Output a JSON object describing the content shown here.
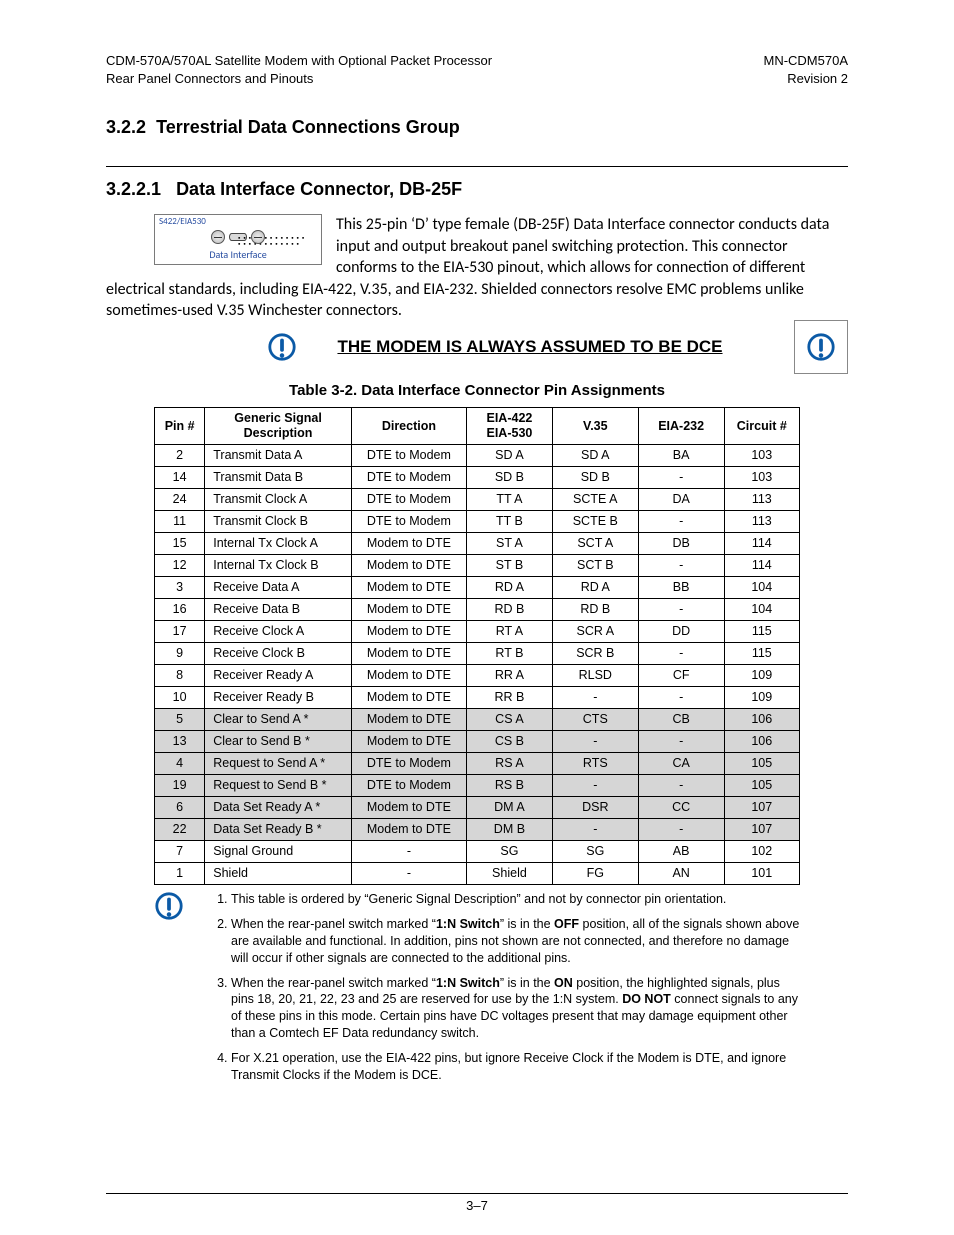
{
  "header": {
    "left_line1": "CDM-570A/570AL Satellite Modem with Optional Packet Processor",
    "left_line2": "Rear Panel Connectors and Pinouts",
    "right_line1": "MN-CDM570A",
    "right_line2": "Revision 2"
  },
  "section_l2": {
    "number": "3.2.2",
    "title": "Terrestrial Data Connections Group"
  },
  "section_l3": {
    "number": "3.2.2.1",
    "title": "Data Interface Connector, DB-25F"
  },
  "connector_fig": {
    "top_label": "S422/EIA530",
    "bottom_label": "Data Interface"
  },
  "intro_paragraph": "This 25-pin ‘D’ type female (DB-25F) Data Interface connector conducts data input and output breakout panel switching protection. This connector conforms to the EIA-530 pinout, which allows for connection of different electrical standards, including EIA-422, V.35, and EIA-232. Shielded connectors resolve EMC problems unlike sometimes-used V.35 Winchester connectors.",
  "dce_banner": "THE MODEM IS ALWAYS ASSUMED TO BE DCE",
  "table_caption": "Table 3-2.  Data Interface Connector Pin Assignments",
  "table": {
    "headers": {
      "pin": "Pin #",
      "desc": "Generic Signal Description",
      "dir": "Direction",
      "e422": "EIA-422 EIA-530",
      "v35": "V.35",
      "e232": "EIA-232",
      "circ": "Circuit #"
    },
    "rows": [
      {
        "pin": "2",
        "desc": "Transmit Data A",
        "dir": "DTE to Modem",
        "e422": "SD A",
        "v35": "SD A",
        "e232": "BA",
        "circ": "103",
        "hl": false
      },
      {
        "pin": "14",
        "desc": "Transmit Data B",
        "dir": "DTE to Modem",
        "e422": "SD B",
        "v35": "SD B",
        "e232": "-",
        "circ": "103",
        "hl": false
      },
      {
        "pin": "24",
        "desc": "Transmit Clock A",
        "dir": "DTE to Modem",
        "e422": "TT A",
        "v35": "SCTE A",
        "e232": "DA",
        "circ": "113",
        "hl": false
      },
      {
        "pin": "11",
        "desc": "Transmit Clock B",
        "dir": "DTE to Modem",
        "e422": "TT B",
        "v35": "SCTE B",
        "e232": "-",
        "circ": "113",
        "hl": false
      },
      {
        "pin": "15",
        "desc": "Internal Tx Clock A",
        "dir": "Modem to DTE",
        "e422": "ST A",
        "v35": "SCT A",
        "e232": "DB",
        "circ": "114",
        "hl": false
      },
      {
        "pin": "12",
        "desc": "Internal Tx Clock B",
        "dir": "Modem to DTE",
        "e422": "ST B",
        "v35": "SCT B",
        "e232": "-",
        "circ": "114",
        "hl": false
      },
      {
        "pin": "3",
        "desc": "Receive Data A",
        "dir": "Modem to DTE",
        "e422": "RD A",
        "v35": "RD A",
        "e232": "BB",
        "circ": "104",
        "hl": false
      },
      {
        "pin": "16",
        "desc": "Receive Data B",
        "dir": "Modem to DTE",
        "e422": "RD B",
        "v35": "RD B",
        "e232": "-",
        "circ": "104",
        "hl": false
      },
      {
        "pin": "17",
        "desc": "Receive Clock A",
        "dir": "Modem to DTE",
        "e422": "RT A",
        "v35": "SCR A",
        "e232": "DD",
        "circ": "115",
        "hl": false
      },
      {
        "pin": "9",
        "desc": "Receive Clock B",
        "dir": "Modem to DTE",
        "e422": "RT B",
        "v35": "SCR B",
        "e232": "-",
        "circ": "115",
        "hl": false
      },
      {
        "pin": "8",
        "desc": "Receiver Ready A",
        "dir": "Modem to DTE",
        "e422": "RR A",
        "v35": "RLSD",
        "e232": "CF",
        "circ": "109",
        "hl": false
      },
      {
        "pin": "10",
        "desc": "Receiver Ready B",
        "dir": "Modem to DTE",
        "e422": "RR B",
        "v35": "-",
        "e232": "-",
        "circ": "109",
        "hl": false
      },
      {
        "pin": "5",
        "desc": "Clear to Send A *",
        "dir": "Modem to DTE",
        "e422": "CS A",
        "v35": "CTS",
        "e232": "CB",
        "circ": "106",
        "hl": true
      },
      {
        "pin": "13",
        "desc": "Clear to Send B *",
        "dir": "Modem to DTE",
        "e422": "CS B",
        "v35": "-",
        "e232": "-",
        "circ": "106",
        "hl": true
      },
      {
        "pin": "4",
        "desc": "Request to Send A *",
        "dir": "DTE to Modem",
        "e422": "RS A",
        "v35": "RTS",
        "e232": "CA",
        "circ": "105",
        "hl": true
      },
      {
        "pin": "19",
        "desc": "Request to Send B *",
        "dir": "DTE to Modem",
        "e422": "RS B",
        "v35": "-",
        "e232": "-",
        "circ": "105",
        "hl": true
      },
      {
        "pin": "6",
        "desc": "Data Set Ready A *",
        "dir": "Modem to DTE",
        "e422": "DM A",
        "v35": "DSR",
        "e232": "CC",
        "circ": "107",
        "hl": true
      },
      {
        "pin": "22",
        "desc": "Data Set Ready B *",
        "dir": "Modem to DTE",
        "e422": "DM B",
        "v35": "-",
        "e232": "-",
        "circ": "107",
        "hl": true
      },
      {
        "pin": "7",
        "desc": "Signal Ground",
        "dir": "-",
        "e422": "SG",
        "v35": "SG",
        "e232": "AB",
        "circ": "102",
        "hl": false
      },
      {
        "pin": "1",
        "desc": "Shield",
        "dir": "-",
        "e422": "Shield",
        "v35": "FG",
        "e232": "AN",
        "circ": "101",
        "hl": false
      }
    ]
  },
  "notes": {
    "n1": "This table is ordered by “Generic Signal Description” and not by connector pin orientation.",
    "n2_a": "When the rear-panel switch marked “",
    "n2_b": "1:N Switch",
    "n2_c": "” is in the ",
    "n2_d": "OFF",
    "n2_e": " position, all of the signals shown above are available and functional. In addition, pins not shown are not connected, and therefore no damage will occur if other signals are connected to the additional pins.",
    "n3_a": "When the rear-panel switch marked “",
    "n3_b": "1:N Switch",
    "n3_c": "” is in the ",
    "n3_d": "ON",
    "n3_e": " position, the highlighted signals, plus pins 18, 20, 21, 22, 23 and 25 are reserved for use by the 1:N system. ",
    "n3_f": "DO NOT",
    "n3_g": " connect signals to any of these pins in this mode. Certain pins have DC voltages present that may damage equipment other than a Comtech EF Data redundancy switch.",
    "n4": "For X.21 operation, use the EIA-422 pins, but ignore Receive Clock if the Modem is DTE, and ignore Transmit Clocks if the Modem is DCE."
  },
  "footer": "3–7"
}
